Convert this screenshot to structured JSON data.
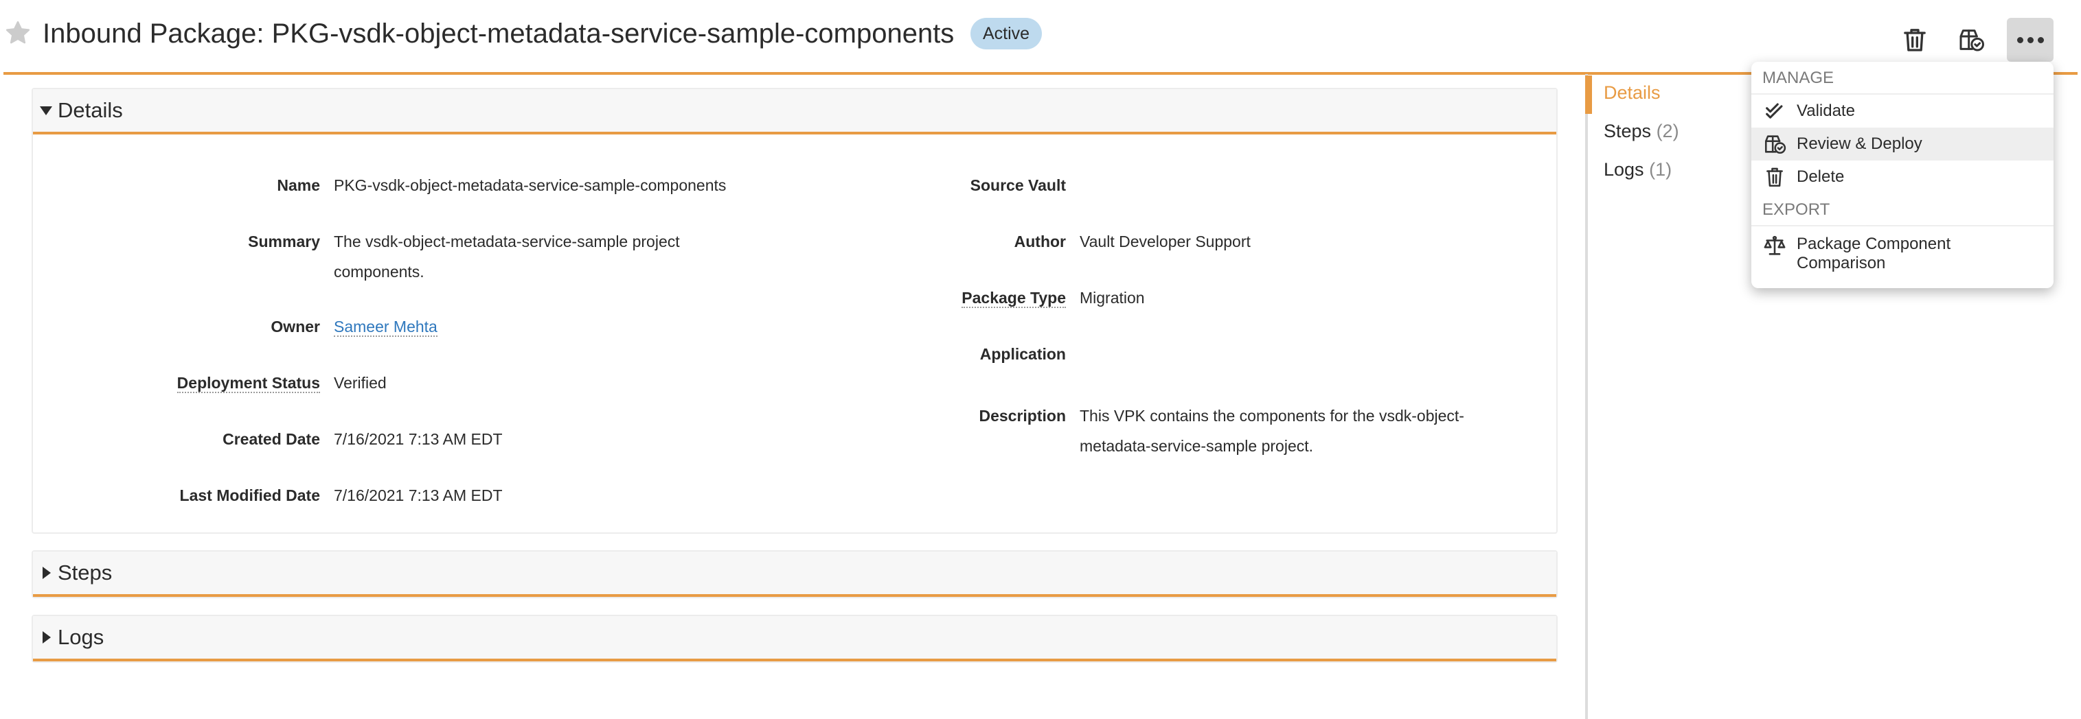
{
  "header": {
    "title": "Inbound Package: PKG-vsdk-object-metadata-service-sample-components",
    "status_badge": "Active",
    "favorite_icon": "star-icon",
    "toolbar": {
      "delete_icon": "trash-icon",
      "deploy_icon": "review-deploy-icon",
      "more_icon": "ellipsis-icon"
    }
  },
  "colors": {
    "accent": "#e89b44",
    "badge_bg": "#bedaee",
    "link": "#2f78bd",
    "panel_header_bg": "#f7f7f7"
  },
  "sections": {
    "details": {
      "title": "Details",
      "expanded": true,
      "left_fields": [
        {
          "label": "Name",
          "value": "PKG-vsdk-object-metadata-service-sample-components"
        },
        {
          "label": "Summary",
          "value": "The vsdk-object-metadata-service-sample project components."
        },
        {
          "label": "Owner",
          "value": "Sameer Mehta"
        },
        {
          "label": "Deployment Status",
          "value": "Verified"
        },
        {
          "label": "Created Date",
          "value": "7/16/2021 7:13 AM EDT"
        },
        {
          "label": "Last Modified Date",
          "value": "7/16/2021 7:13 AM EDT"
        }
      ],
      "right_fields": [
        {
          "label": "Source Vault",
          "value": ""
        },
        {
          "label": "Author",
          "value": "Vault Developer Support"
        },
        {
          "label": "Package Type",
          "value": "Migration"
        },
        {
          "label": "Application",
          "value": ""
        },
        {
          "label": "Description",
          "value": "This VPK contains the components for the vsdk-object-metadata-service-sample project."
        }
      ]
    },
    "steps": {
      "title": "Steps",
      "expanded": false
    },
    "logs": {
      "title": "Logs",
      "expanded": false
    }
  },
  "sidebar": {
    "items": [
      {
        "label": "Details",
        "count": "",
        "active": true
      },
      {
        "label": "Steps",
        "count": "(2)",
        "active": false
      },
      {
        "label": "Logs",
        "count": "(1)",
        "active": false
      }
    ]
  },
  "menu": {
    "sections": [
      {
        "title": "MANAGE",
        "items": [
          {
            "label": "Validate",
            "icon": "double-check-icon"
          },
          {
            "label": "Review & Deploy",
            "icon": "review-deploy-icon",
            "hovered": true
          },
          {
            "label": "Delete",
            "icon": "trash-icon"
          }
        ]
      },
      {
        "title": "EXPORT",
        "items": [
          {
            "label": "Package Component Comparison",
            "icon": "scale-icon"
          }
        ]
      }
    ]
  }
}
